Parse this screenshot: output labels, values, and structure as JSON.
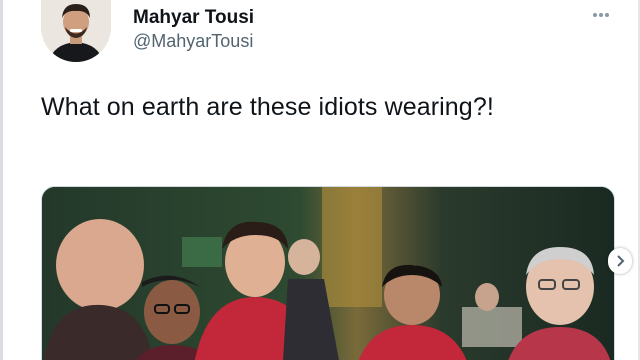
{
  "tweet": {
    "author": {
      "display_name": "Mahyar Tousi",
      "handle": "@MahyarTousi",
      "avatar_icon": "profile-photo"
    },
    "more_icon": "more-horizontal-icon",
    "text": "What on earth are these idiots wearing?!",
    "media": {
      "kind": "photo"
    }
  },
  "colors": {
    "text_primary": "#0f1419",
    "text_secondary": "#536471",
    "shirt_red": "#c2283a"
  }
}
